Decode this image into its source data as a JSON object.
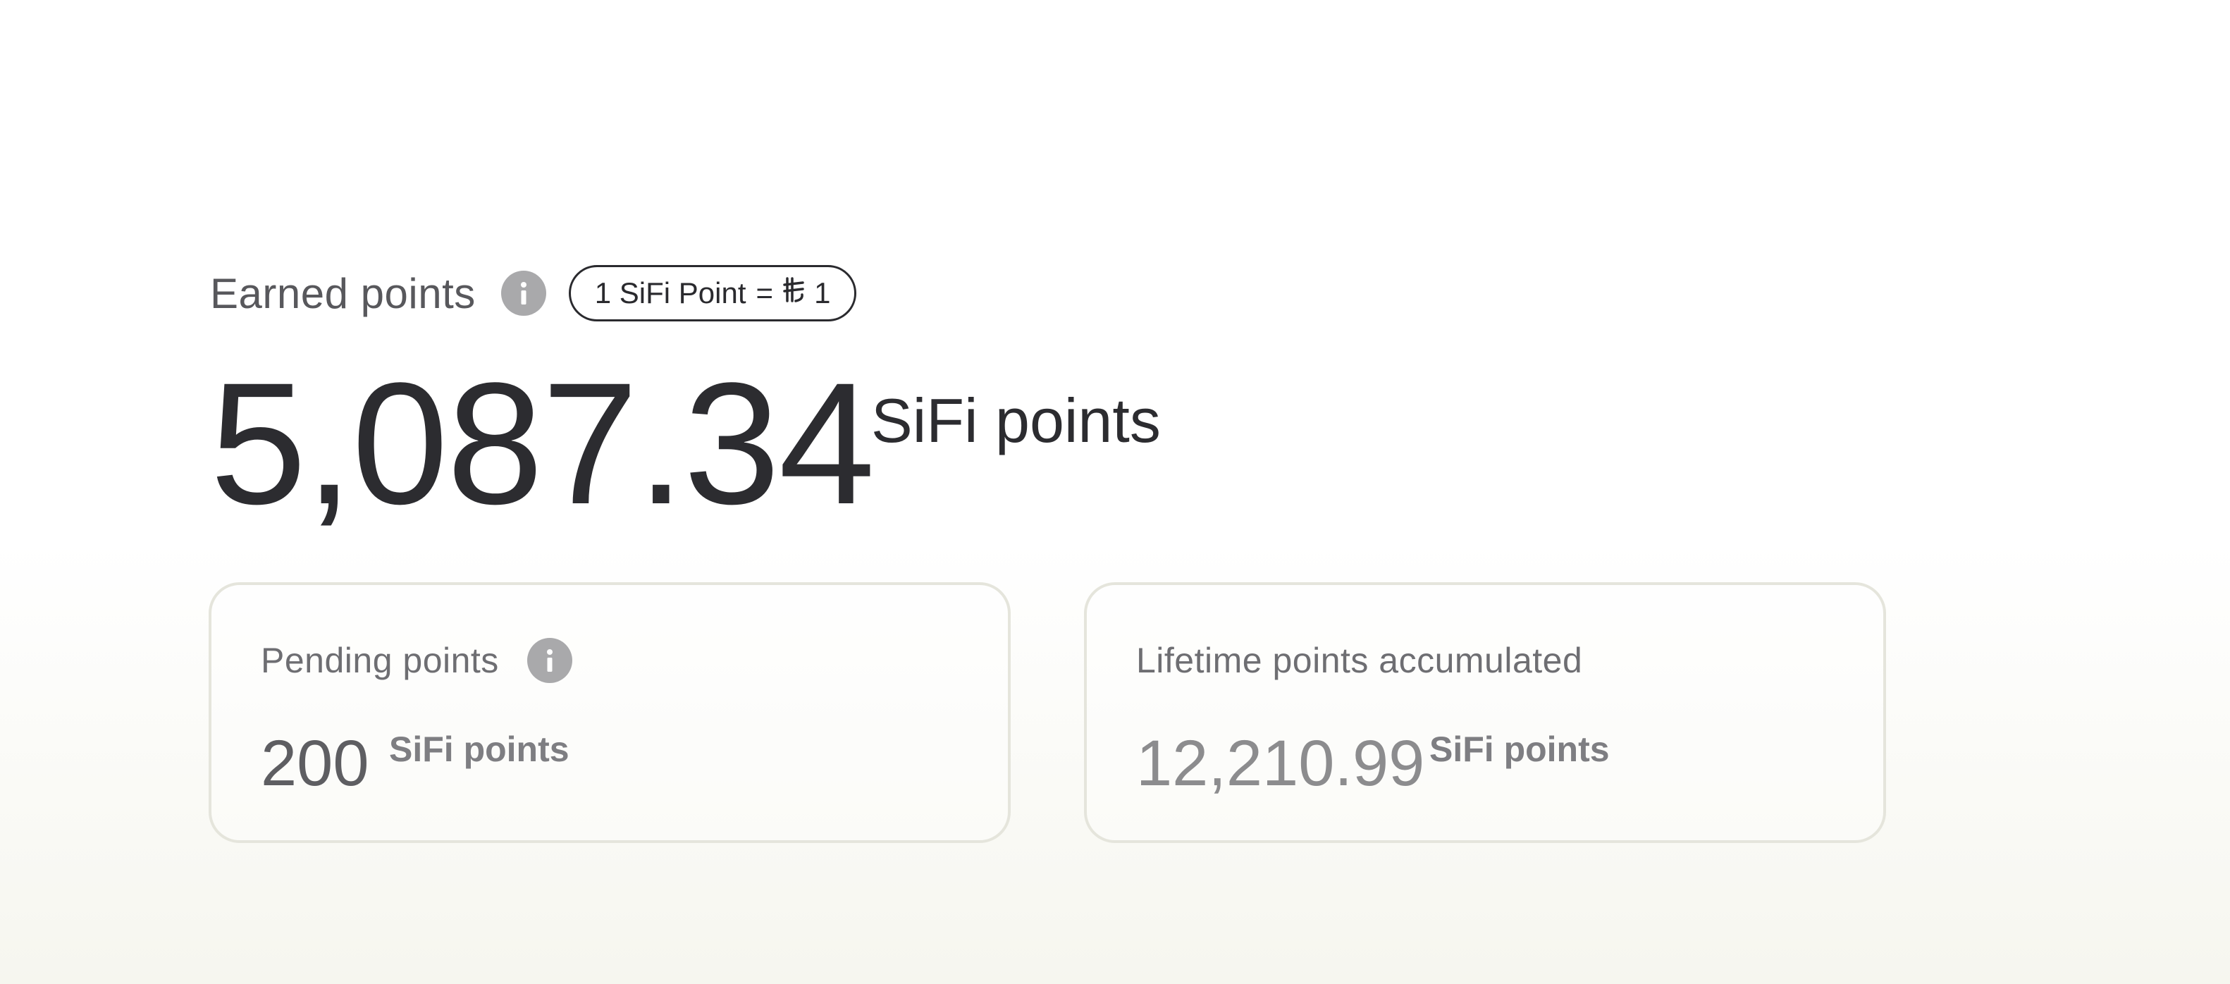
{
  "earned": {
    "label": "Earned points",
    "info_icon": "info-icon",
    "rate": {
      "left": "1 SiFi Point",
      "equals": "=",
      "currency_symbol": "₿",
      "right": "1"
    },
    "value": "5,087.34",
    "unit": "SiFi points"
  },
  "cards": {
    "pending": {
      "title": "Pending points",
      "info_icon": "info-icon",
      "value": "200",
      "unit": "SiFi points"
    },
    "lifetime": {
      "title": "Lifetime points accumulated",
      "value": "12,210.99",
      "unit": "SiFi points"
    }
  },
  "colors": {
    "text_primary": "#2c2c30",
    "text_secondary": "#58585c",
    "info_icon_bg": "#a9a9ab",
    "card_border": "#e5e5dc"
  }
}
